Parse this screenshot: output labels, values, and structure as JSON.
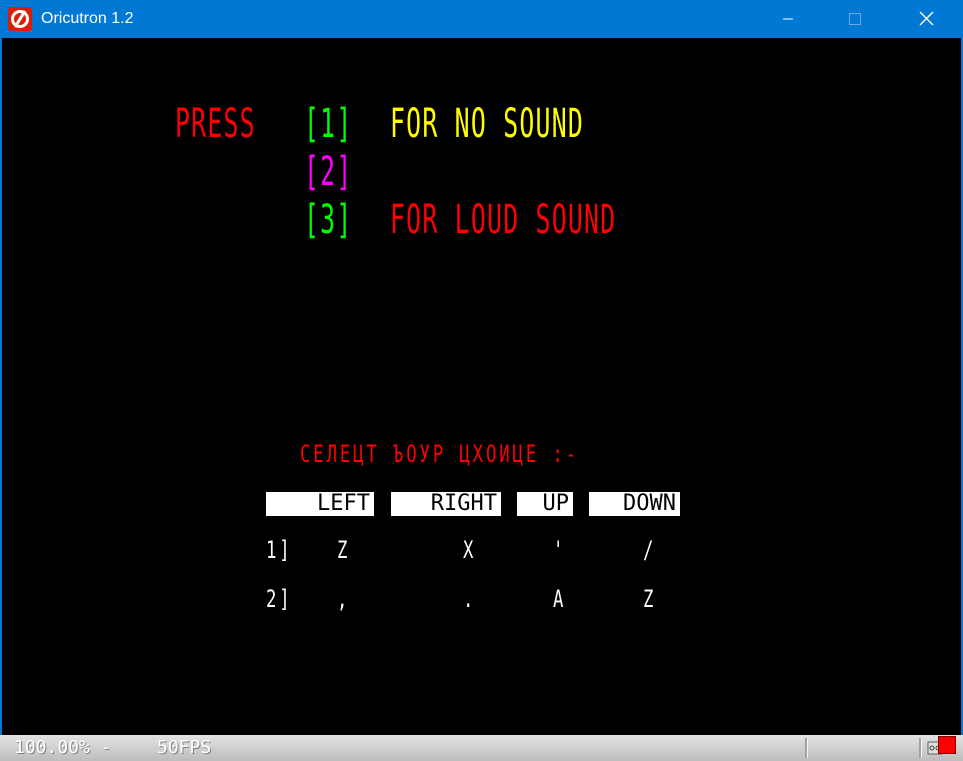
{
  "window": {
    "title": "Oricutron 1.2",
    "icon": "oricutron-logo-icon",
    "controls": [
      "minimize-icon",
      "maximize-icon",
      "close-icon"
    ]
  },
  "screen": {
    "press": "PRESS",
    "options": [
      {
        "key": "[1]",
        "text": "FOR NO SOUND",
        "key_color": "#00ff00",
        "text_color": "#ffff00"
      },
      {
        "key": "[2]",
        "text": "",
        "key_color": "#ff00ff",
        "text_color": "#ffffff"
      },
      {
        "key": "[3]",
        "text": "FOR LOUD SOUND",
        "key_color": "#00ff00",
        "text_color": "#ff0000"
      }
    ],
    "select_prompt": "СЕЛЕЦТ ЪОУР ЦХОИЦЕ :-",
    "headers": [
      "LEFT",
      "RIGHT",
      "UP",
      "DOWN"
    ],
    "rows": [
      {
        "label": "1]",
        "keys": [
          "Z",
          "X",
          "'",
          "/"
        ]
      },
      {
        "label": "2]",
        "keys": [
          ",",
          ".",
          "A",
          "Z"
        ]
      }
    ],
    "colors": {
      "red": "#ff0000",
      "yellow": "#ffff00",
      "green": "#00ff00",
      "magenta": "#ff00ff",
      "white": "#ffffff",
      "black": "#000000"
    }
  },
  "statusbar": {
    "speed": "100.00% -",
    "fps": "50FPS",
    "disk_led_color": "#ff0000"
  }
}
